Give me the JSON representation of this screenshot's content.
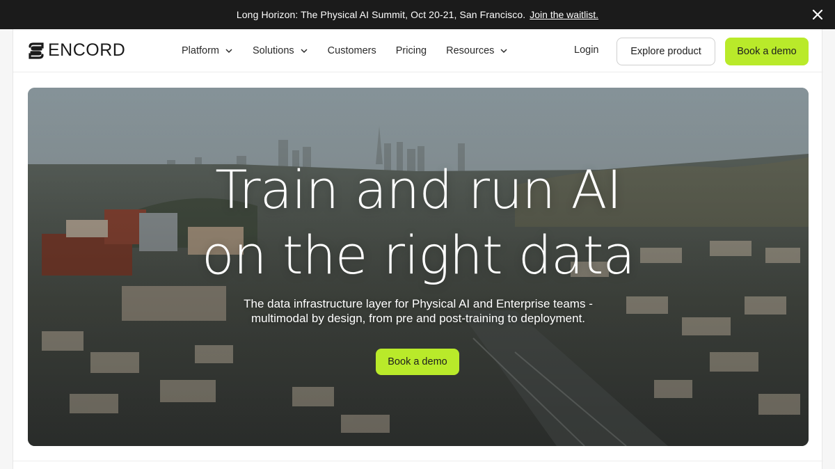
{
  "announcement": {
    "message": "Long Horizon: The Physical AI Summit, Oct 20-21, San Francisco.",
    "link_label": "Join the waitlist."
  },
  "brand": {
    "name": "ENCORD",
    "accent": "#b9ea2a"
  },
  "nav": {
    "items": [
      {
        "label": "Platform",
        "has_dropdown": true
      },
      {
        "label": "Solutions",
        "has_dropdown": true
      },
      {
        "label": "Customers",
        "has_dropdown": false
      },
      {
        "label": "Pricing",
        "has_dropdown": false
      },
      {
        "label": "Resources",
        "has_dropdown": true
      }
    ],
    "login_label": "Login",
    "explore_label": "Explore product",
    "demo_label": "Book a demo"
  },
  "hero": {
    "title_line1": "Train and run AI",
    "title_line2": "on the right data",
    "subtitle_line1": "The data infrastructure layer for Physical AI and Enterprise teams -",
    "subtitle_line2": "multimodal by design, from pre and post-training to deployment.",
    "cta_label": "Book a demo"
  }
}
